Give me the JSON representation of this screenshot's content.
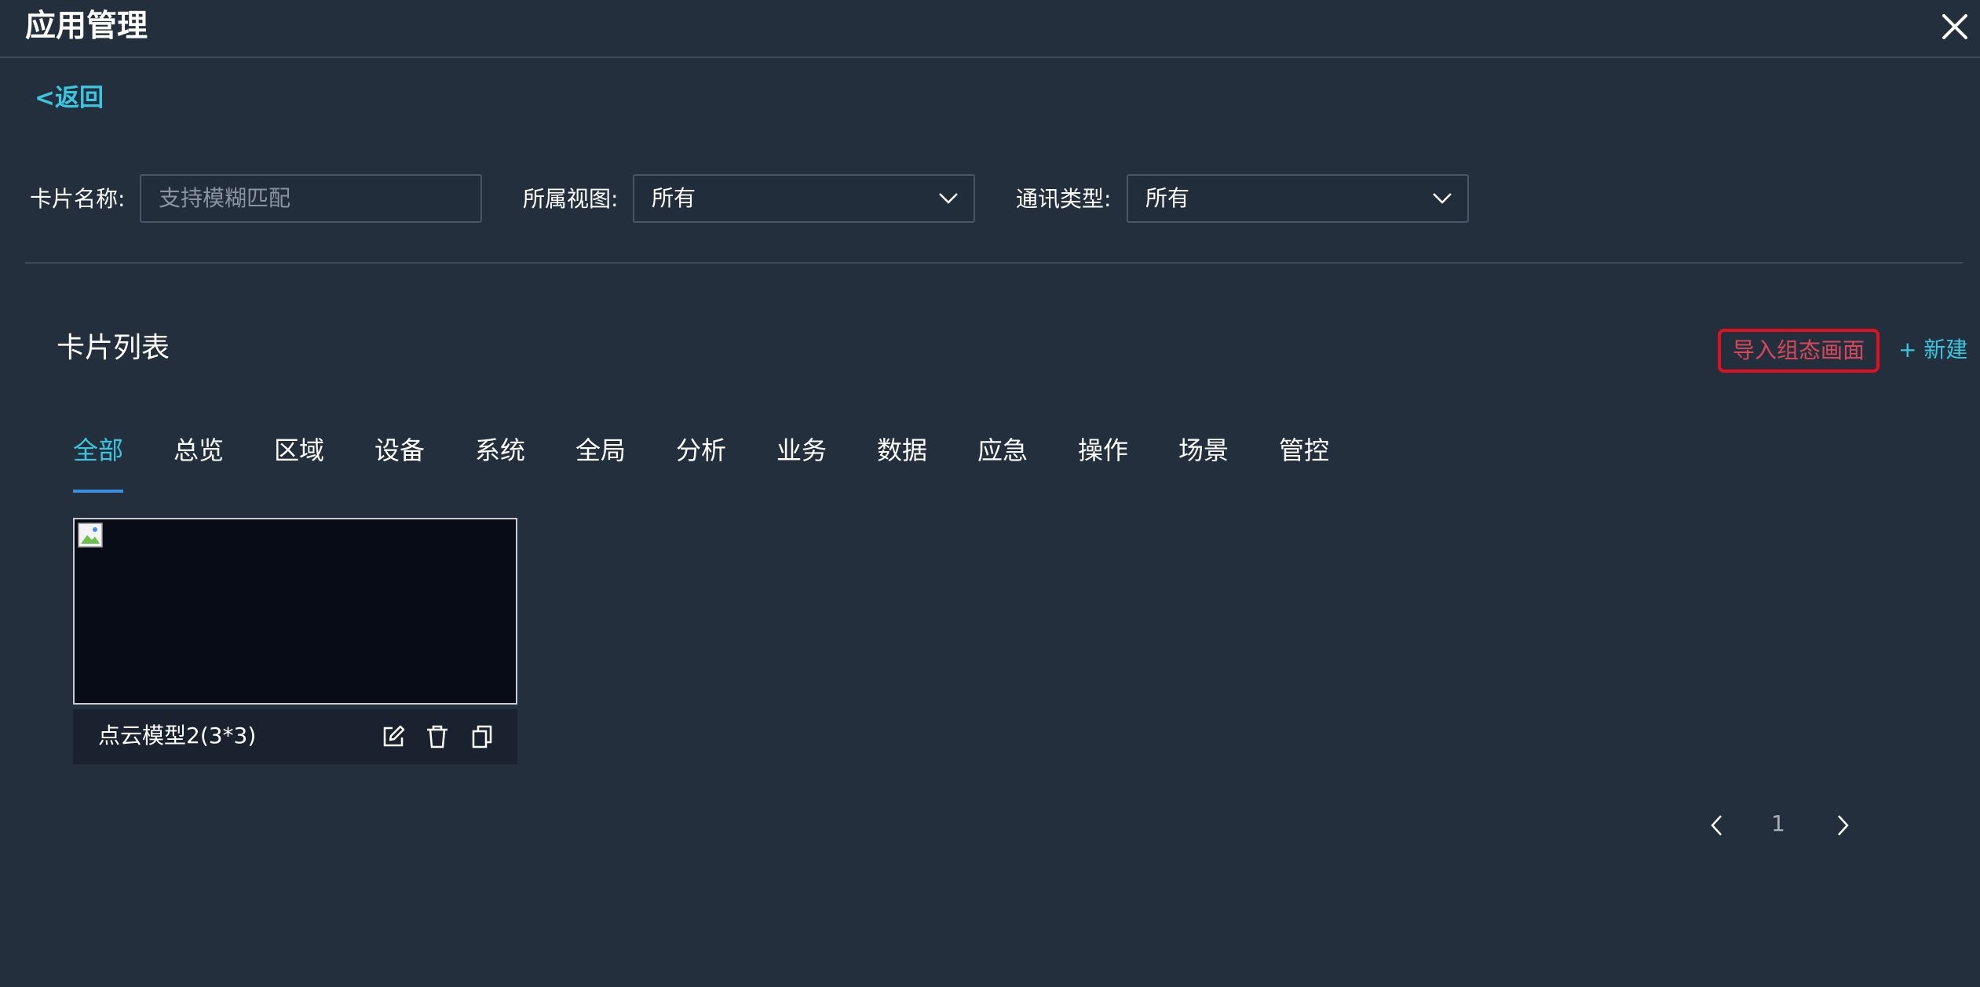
{
  "window": {
    "title": "应用管理",
    "close_icon": "close-icon"
  },
  "back": {
    "label": "<返回"
  },
  "filters": {
    "card_name": {
      "label": "卡片名称:",
      "placeholder": "支持模糊匹配",
      "value": ""
    },
    "view": {
      "label": "所属视图:",
      "value": "所有"
    },
    "comm_type": {
      "label": "通讯类型:",
      "value": "所有"
    }
  },
  "section": {
    "title": "卡片列表",
    "import_label": "导入组态画面",
    "new_label": "+ 新建"
  },
  "tabs": [
    {
      "label": "全部",
      "active": true
    },
    {
      "label": "总览"
    },
    {
      "label": "区域"
    },
    {
      "label": "设备"
    },
    {
      "label": "系统"
    },
    {
      "label": "全局"
    },
    {
      "label": "分析"
    },
    {
      "label": "业务"
    },
    {
      "label": "数据"
    },
    {
      "label": "应急"
    },
    {
      "label": "操作"
    },
    {
      "label": "场景"
    },
    {
      "label": "管控"
    }
  ],
  "cards": [
    {
      "name": "点云模型2(3*3)",
      "actions": [
        "edit-icon",
        "trash-icon",
        "copy-icon"
      ]
    }
  ],
  "pagination": {
    "current": "1"
  },
  "colors": {
    "background": "#232f3d",
    "accent": "#3bc6e0",
    "highlight": "#e01020"
  }
}
